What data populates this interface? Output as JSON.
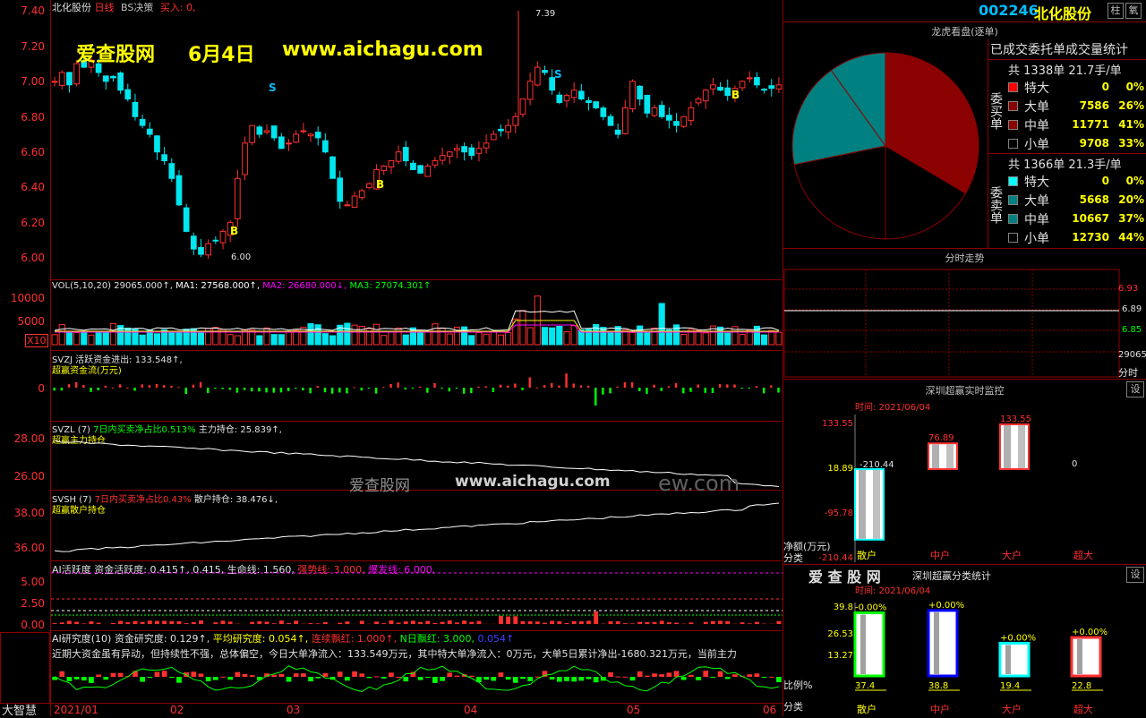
{
  "colors": {
    "up": "#ff3030",
    "down": "#00e5ee",
    "ma1": "#ffffff",
    "ma2": "#ffff00",
    "ma3": "#ff00ff",
    "yellow": "#ffff00",
    "green": "#00ff00",
    "cyan": "#00ffff",
    "darkred": "#8b0000",
    "teal": "#008080"
  },
  "kline": {
    "title": "北化股份",
    "period": "日线",
    "bs": "BS决策",
    "buy": "买入: 0,",
    "yaxis": [
      "7.40",
      "7.20",
      "7.00",
      "6.80",
      "6.60",
      "6.40",
      "6.20",
      "6.00"
    ],
    "watermark_site": "爱查股网",
    "watermark_date": "6月4日",
    "watermark_url": "www.aichagu.com",
    "high_label": "7.39",
    "low_label": "6.00",
    "signals": [
      "S",
      "S",
      "B",
      "B",
      "B"
    ]
  },
  "vol": {
    "title": "VOL(5,10,20) 29065.000↑,",
    "ma1": "MA1: 27568.000↑,",
    "ma2": "MA2: 26680.000↓,",
    "ma3": "MA3: 27074.301↑",
    "y1": "10000",
    "y2": "5000",
    "unit": "X10"
  },
  "svzj": {
    "title": "SVZJ  活跃资金进出: 133.548↑,",
    "sub": "超赢资金流(万元)",
    "y": "0"
  },
  "svzl": {
    "title": "SVZL (7)",
    "ratio": "7日内买卖净占比0.513%",
    "hold": "主力持仓: 25.839↑,",
    "sub": "超赢主力持仓",
    "y1": "28.00",
    "y2": "26.00"
  },
  "svsh": {
    "title": "SVSH (7)",
    "ratio": "7日内买卖净占比0.43%",
    "hold": "散户持仓: 38.476↓,",
    "sub": "超赢散户持仓",
    "y1": "38.00",
    "y2": "36.00"
  },
  "mid_watermark": {
    "site": "爱查股网",
    "url": "www.aichagu.com",
    "suffix": "ew.com"
  },
  "ai_active": {
    "title": "AI活跃度",
    "a": "资金活跃度: 0.415↑,",
    "b": "0.415,",
    "c": "生命线: 1.560,",
    "d": "强势线: 3.000,",
    "e": "爆发线: 6.000,",
    "y1": "5.00",
    "y2": "2.50",
    "y3": "0.00"
  },
  "ai_research": {
    "title": "AI研究度(10)",
    "a": "资金研究度: 0.129↑,",
    "b": "平均研究度: 0.054↑,",
    "c": "连续飘红: 1.000↑,",
    "d": "N日飘红: 3.000,",
    "e": "0.054↑",
    "comment": "近期大资金虽有异动，但持续性不强，总体偏空，今日大单净流入：133.549万元，其中特大单净流入：0万元，大单5日累计净出-1680.321万元，当前主力"
  },
  "bottom": {
    "brand": "大智慧",
    "dates": [
      "2021/01",
      "02",
      "03",
      "04",
      "05",
      "06"
    ]
  },
  "right": {
    "code": "002246",
    "name": "北化股份",
    "btn1": "柱",
    "btn2": "氧",
    "lhb": "龙虎看盘(逐单)",
    "stat_title": "已成交委托单成交量统计",
    "buy_total": "共 1338单 21.7手/单",
    "buy_side": "委买单",
    "buy_rows": [
      {
        "label": "特大",
        "num": "0",
        "pct": "0%"
      },
      {
        "label": "大单",
        "num": "7586",
        "pct": "26%"
      },
      {
        "label": "中单",
        "num": "11771",
        "pct": "41%"
      },
      {
        "label": "小单",
        "num": "9708",
        "pct": "33%"
      }
    ],
    "sell_total": "共 1366单 21.3手/单",
    "sell_side": "委卖单",
    "sell_rows": [
      {
        "label": "特大",
        "num": "0",
        "pct": "0%"
      },
      {
        "label": "大单",
        "num": "5668",
        "pct": "20%"
      },
      {
        "label": "中单",
        "num": "10667",
        "pct": "37%"
      },
      {
        "label": "小单",
        "num": "12730",
        "pct": "44%"
      }
    ],
    "pie": {
      "buy": [
        0,
        26,
        41,
        33
      ],
      "sell": [
        0,
        20,
        37,
        44
      ]
    },
    "fenshi": "分时走势",
    "fs_y": [
      "6.93",
      "6.89",
      "6.85"
    ],
    "fs_vol": "29065",
    "fs_unit": "分时",
    "monitor": "深圳超赢实时监控",
    "set": "设",
    "time": "时间: 2021/06/04",
    "mon_y": [
      "133.55",
      "18.89",
      "-95.78",
      "-210.44"
    ],
    "mon_values": [
      -210.44,
      76.89,
      133.55,
      0
    ],
    "mon_labels": [
      "-210.44",
      "76.89",
      "133.55",
      "0"
    ],
    "mon_unit": "净额(万元)",
    "fenlei": "分类",
    "cats": [
      "散户",
      "中户",
      "大户",
      "超大"
    ],
    "logo": "爱 查 股 网",
    "classify": "深圳超赢分类统计",
    "cls_y": [
      "39.8",
      "26.53",
      "13.27"
    ],
    "cls_values": [
      37.4,
      38.8,
      19.4,
      22.8
    ],
    "cls_top": [
      "-0.00%",
      "+0.00%",
      "+0.00%",
      "+0.00%"
    ],
    "cls_bottom": [
      "37.4",
      "38.8",
      "19.4",
      "22.8"
    ],
    "ratio": "比例%"
  }
}
